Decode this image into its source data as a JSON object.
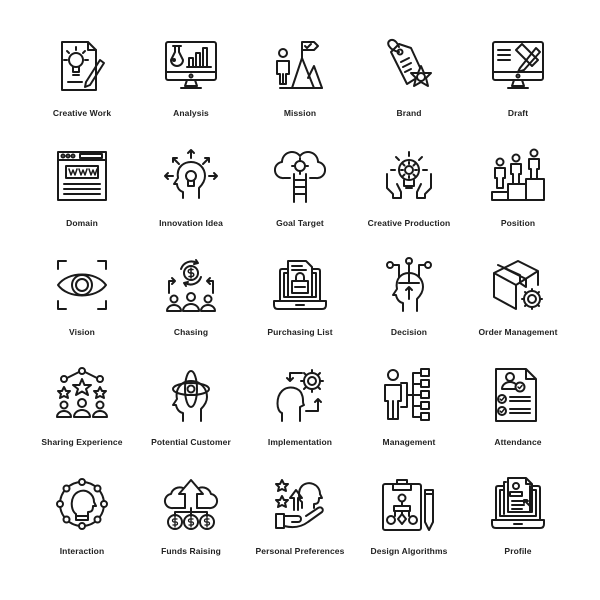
{
  "background": "#ffffff",
  "stroke_color": "#1a1a1a",
  "rows": [
    [
      {
        "label": "Creative Work",
        "icon": "lightbulb-document-pencil-icon"
      },
      {
        "label": "Analysis",
        "icon": "monitor-flask-bar-chart-icon"
      },
      {
        "label": "Mission",
        "icon": "person-mountain-flag-icon"
      },
      {
        "label": "Brand",
        "icon": "price-tag-star-dollar-icon"
      },
      {
        "label": "Draft",
        "icon": "monitor-ruler-pencil-icon"
      }
    ],
    [
      {
        "label": "Domain",
        "icon": "browser-www-icon"
      },
      {
        "label": "Innovation Idea",
        "icon": "head-lightbulb-arrows-icon"
      },
      {
        "label": "Goal Target",
        "icon": "cloud-target-ladder-icon"
      },
      {
        "label": "Creative Production",
        "icon": "hands-lightbulb-gear-icon"
      },
      {
        "label": "Position",
        "icon": "podium-people-icon"
      }
    ],
    [
      {
        "label": "Vision",
        "icon": "eye-focus-frame-icon"
      },
      {
        "label": "Chasing",
        "icon": "people-dollar-cycle-icon"
      },
      {
        "label": "Purchasing List",
        "icon": "laptop-document-shopping-bag-icon"
      },
      {
        "label": "Decision",
        "icon": "head-branching-arrow-icon"
      },
      {
        "label": "Order Management",
        "icon": "box-gear-icon"
      }
    ],
    [
      {
        "label": "Sharing Experience",
        "icon": "people-stars-network-icon"
      },
      {
        "label": "Potential Customer",
        "icon": "head-orbit-icon"
      },
      {
        "label": "Implementation",
        "icon": "head-gear-arrows-icon"
      },
      {
        "label": "Management",
        "icon": "person-hierarchy-icon"
      },
      {
        "label": "Attendance",
        "icon": "document-user-checklist-icon"
      }
    ],
    [
      {
        "label": "Interaction",
        "icon": "head-network-ring-icon"
      },
      {
        "label": "Funds Raising",
        "icon": "cloud-arrow-dollar-coins-icon"
      },
      {
        "label": "Personal Preferences",
        "icon": "hand-head-stars-icon"
      },
      {
        "label": "Design Algorithms",
        "icon": "clipboard-flowchart-pencil-icon"
      },
      {
        "label": "Profile",
        "icon": "laptop-profile-document-icon"
      }
    ]
  ]
}
